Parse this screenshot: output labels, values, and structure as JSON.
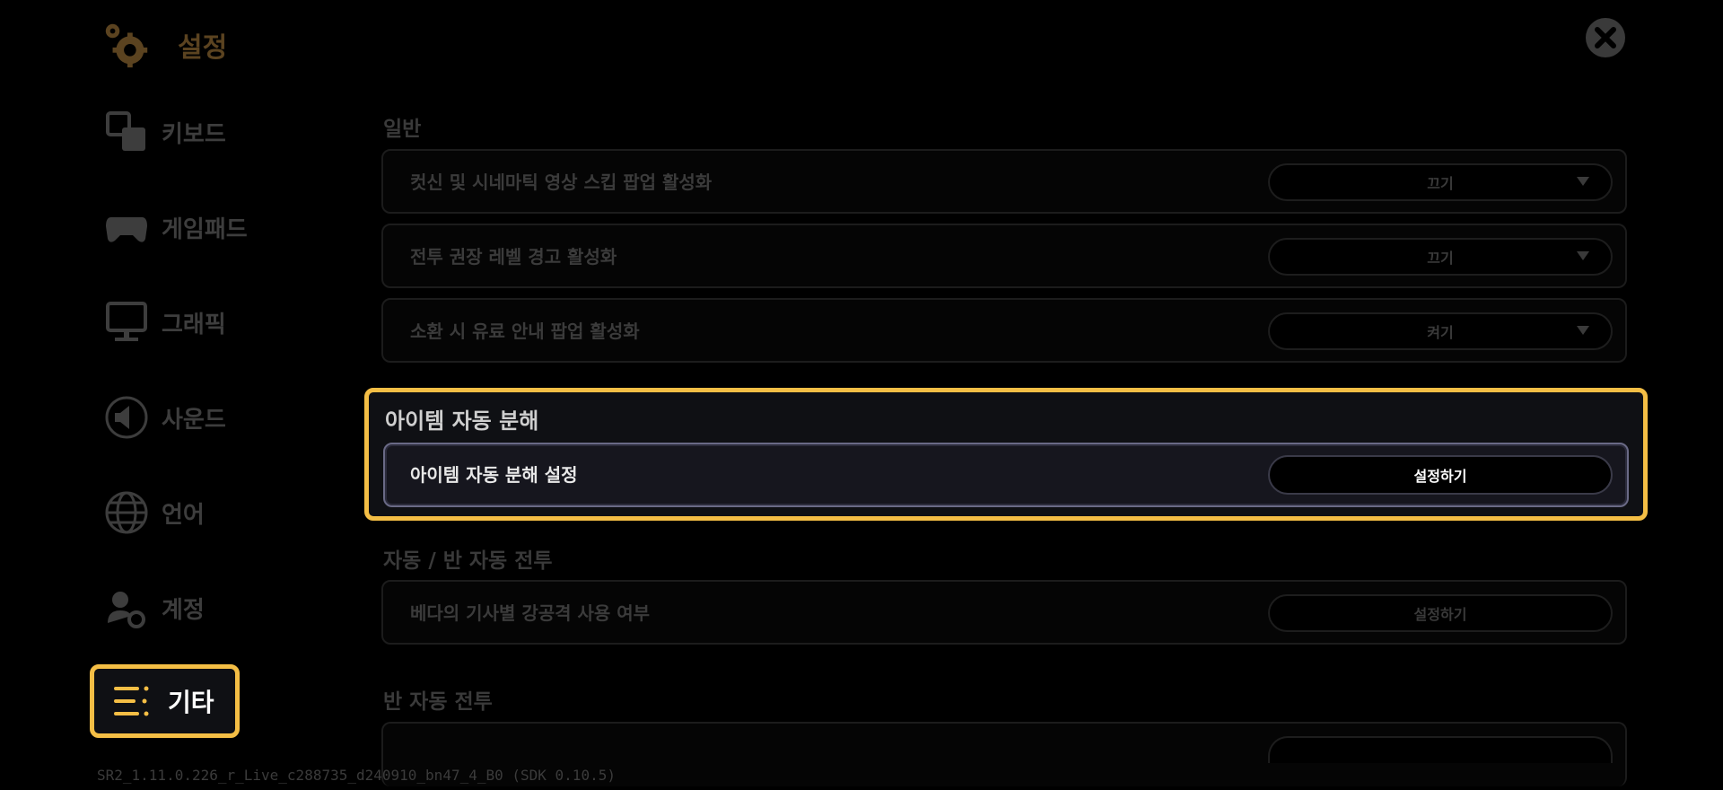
{
  "header": {
    "title": "설정"
  },
  "sidebar": {
    "items": [
      {
        "label": "키보드",
        "icon": "keyboard-icon"
      },
      {
        "label": "게임패드",
        "icon": "gamepad-icon"
      },
      {
        "label": "그래픽",
        "icon": "monitor-icon"
      },
      {
        "label": "사운드",
        "icon": "speaker-icon"
      },
      {
        "label": "언어",
        "icon": "globe-icon"
      },
      {
        "label": "계정",
        "icon": "account-icon"
      },
      {
        "label": "기타",
        "icon": "menu-icon",
        "active": true
      }
    ]
  },
  "sections": {
    "general": {
      "title": "일반",
      "rows": [
        {
          "label": "컷신 및 시네마틱 영상 스킵 팝업 활성화",
          "value": "끄기"
        },
        {
          "label": "전투 권장 레벨 경고 활성화",
          "value": "끄기"
        },
        {
          "label": "소환 시 유료 안내 팝업 활성화",
          "value": "켜기"
        }
      ]
    },
    "auto_dismantle": {
      "title": "아이템 자동 분해",
      "row": {
        "label": "아이템 자동 분해 설정",
        "button": "설정하기"
      }
    },
    "auto_battle": {
      "title": "자동 / 반 자동 전투",
      "row": {
        "label": "베다의 기사별 강공격 사용 여부",
        "button": "설정하기"
      }
    },
    "semi_auto_battle": {
      "title": "반 자동 전투"
    }
  },
  "version": "SR2_1.11.0.226_r_Live_c288735_d240910_bn47_4_B0 (SDK 0.10.5)",
  "colors": {
    "accent": "#f4be45",
    "background": "#000000",
    "title_brown": "#5b4320"
  }
}
